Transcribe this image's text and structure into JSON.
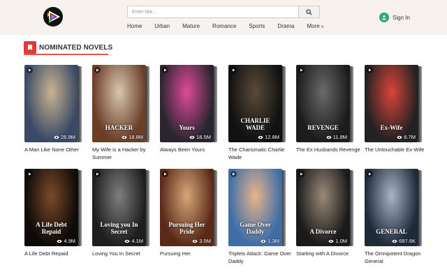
{
  "header": {
    "search": {
      "placeholder": "Enter title..."
    },
    "nav": [
      "Home",
      "Urban",
      "Mature",
      "Romance",
      "Sports",
      "Drama",
      "More"
    ],
    "signin_label": "Sign In"
  },
  "section": {
    "title": "NOMINATED NOVELS"
  },
  "books": [
    {
      "title": "A Man Like None Other",
      "views": "26.9M",
      "cover_text": "",
      "palette": [
        "#3a4a66",
        "#c9b38f"
      ]
    },
    {
      "title": "My Wife is a Hacker by Summer",
      "views": "18.8M",
      "cover_text": "HACKER",
      "palette": [
        "#6b3e28",
        "#d8c6b0"
      ]
    },
    {
      "title": "Always Been Yours",
      "views": "18.5M",
      "cover_text": "Yours",
      "palette": [
        "#2a2630",
        "#e04a9a"
      ]
    },
    {
      "title": "The Charismatic Charlie Wade",
      "views": "12.8M",
      "cover_text": "CHARLIE WADE",
      "palette": [
        "#111111",
        "#5a4a3a"
      ]
    },
    {
      "title": "The Ex Husbands Revenge",
      "views": "11.8M",
      "cover_text": "REVENGE",
      "palette": [
        "#1c1c1c",
        "#6a6a6a"
      ]
    },
    {
      "title": "The Untouchable Ex-Wife",
      "views": "6.7M",
      "cover_text": "Ex-Wife",
      "palette": [
        "#222222",
        "#d9443b"
      ]
    },
    {
      "title": "A Life Debt Repaid",
      "views": "4.9M",
      "cover_text": "A Life Debt Repaid",
      "palette": [
        "#0e0a08",
        "#7a4a2a"
      ]
    },
    {
      "title": "Loving You In Secret",
      "views": "4.1M",
      "cover_text": "Loving you In Secret",
      "palette": [
        "#1e1e1e",
        "#7e7e7e"
      ]
    },
    {
      "title": "Pursuing Her",
      "views": "3.5M",
      "cover_text": "Pursuing Her Pride",
      "palette": [
        "#5a2a18",
        "#d7a67a"
      ]
    },
    {
      "title": "Triplets Attack: Game Over Daddy",
      "views": "1.3M",
      "cover_text": "Game Over Daddy",
      "palette": [
        "#3e6ea8",
        "#e8b48a"
      ]
    },
    {
      "title": "Starting with A Divorce",
      "views": "1.0M",
      "cover_text": "A Divorce",
      "palette": [
        "#1a1a1a",
        "#9a8a78"
      ]
    },
    {
      "title": "The Omnipotent Dragon General",
      "views": "687.6K",
      "cover_text": "GENERAL",
      "palette": [
        "#1e2a3a",
        "#a9b4c4"
      ]
    }
  ]
}
